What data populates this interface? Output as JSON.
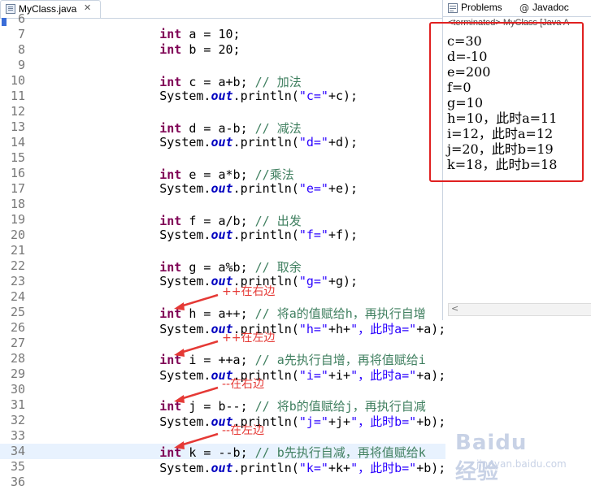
{
  "editor": {
    "tab_title": "MyClass.java",
    "tab_close": "✕",
    "current_line": 34,
    "lines": [
      {
        "n": "6",
        "code": ""
      },
      {
        "n": "7",
        "code": "        int a = 10;"
      },
      {
        "n": "8",
        "code": "        int b = 20;"
      },
      {
        "n": "9",
        "code": ""
      },
      {
        "n": "10",
        "code": "        int c = a+b; // 加法"
      },
      {
        "n": "11",
        "code": "        System.out.println(\"c=\"+c);"
      },
      {
        "n": "12",
        "code": ""
      },
      {
        "n": "13",
        "code": "        int d = a-b; // 减法"
      },
      {
        "n": "14",
        "code": "        System.out.println(\"d=\"+d);"
      },
      {
        "n": "15",
        "code": ""
      },
      {
        "n": "16",
        "code": "        int e = a*b; //乘法"
      },
      {
        "n": "17",
        "code": "        System.out.println(\"e=\"+e);"
      },
      {
        "n": "18",
        "code": ""
      },
      {
        "n": "19",
        "code": "        int f = a/b; // 出发"
      },
      {
        "n": "20",
        "code": "        System.out.println(\"f=\"+f);"
      },
      {
        "n": "21",
        "code": ""
      },
      {
        "n": "22",
        "code": "        int g = a%b; // 取余"
      },
      {
        "n": "23",
        "code": "        System.out.println(\"g=\"+g);"
      },
      {
        "n": "24",
        "code": ""
      },
      {
        "n": "25",
        "code": "        int h = a++; // 将a的值赋给h，再执行自增"
      },
      {
        "n": "26",
        "code": "        System.out.println(\"h=\"+h+\"，此时a=\"+a);"
      },
      {
        "n": "27",
        "code": ""
      },
      {
        "n": "28",
        "code": "        int i = ++a; // a先执行自增，再将值赋给i"
      },
      {
        "n": "29",
        "code": "        System.out.println(\"i=\"+i+\"，此时a=\"+a);"
      },
      {
        "n": "30",
        "code": ""
      },
      {
        "n": "31",
        "code": "        int j = b--; // 将b的值赋给j，再执行自减"
      },
      {
        "n": "32",
        "code": "        System.out.println(\"j=\"+j+\"，此时b=\"+b);"
      },
      {
        "n": "33",
        "code": ""
      },
      {
        "n": "34",
        "code": "        int k = --b; // b先执行自减，再将值赋给k"
      },
      {
        "n": "35",
        "code": "        System.out.println(\"k=\"+k+\"，此时b=\"+b);"
      },
      {
        "n": "36",
        "code": ""
      }
    ]
  },
  "annotations": [
    {
      "text": "++在右边",
      "line": "25"
    },
    {
      "text": "++在左边",
      "line": "28"
    },
    {
      "text": "--在右边",
      "line": "31"
    },
    {
      "text": "--在左边",
      "line": "34"
    }
  ],
  "side_panel": {
    "tabs": [
      {
        "label": "Problems",
        "icon": "problems-icon"
      },
      {
        "label": "Javadoc",
        "icon": "javadoc-icon"
      }
    ],
    "console_header": "<terminated> MyClass [Java A",
    "output": [
      "c=30",
      "d=-10",
      "e=200",
      "f=0",
      "g=10",
      "h=10，此时a=11",
      "i=12，此时a=12",
      "j=20，此时b=19",
      "k=18，此时b=18"
    ],
    "scroll_left_arrow": "<"
  },
  "watermark": {
    "logo": "Baidu经验",
    "url": "jingyan.baidu.com"
  },
  "colors": {
    "keyword": "#7f0055",
    "field": "#0000c0",
    "string": "#2a00ff",
    "comment": "#3f7f5f",
    "annotation": "#e53935",
    "highlight_box": "#e02020"
  }
}
